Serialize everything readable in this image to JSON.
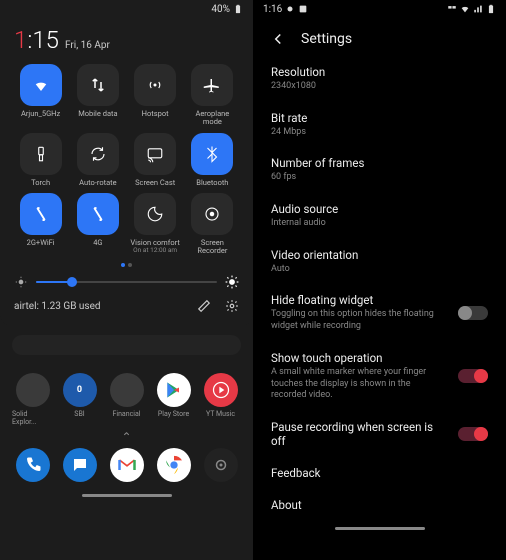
{
  "left": {
    "status": {
      "battery": "40%"
    },
    "clock": {
      "hour": "1",
      "rest": ":15",
      "date": "Fri, 16 Apr"
    },
    "tiles": [
      {
        "name": "wifi",
        "label": "Arjun_5GHz",
        "on": true
      },
      {
        "name": "mobile-data",
        "label": "Mobile data",
        "on": false
      },
      {
        "name": "hotspot",
        "label": "Hotspot",
        "on": false
      },
      {
        "name": "aeroplane",
        "label": "Aeroplane mode",
        "on": false
      },
      {
        "name": "torch",
        "label": "Torch",
        "on": false
      },
      {
        "name": "auto-rotate",
        "label": "Auto-rotate",
        "on": false
      },
      {
        "name": "screen-cast",
        "label": "Screen Cast",
        "on": false
      },
      {
        "name": "bluetooth",
        "label": "Bluetooth",
        "on": true
      },
      {
        "name": "2g-wifi",
        "label": "2G+WiFi",
        "on": true
      },
      {
        "name": "4g",
        "label": "4G",
        "on": true
      },
      {
        "name": "vision-comfort",
        "label": "Vision comfort",
        "sub": "On at 12:00 am",
        "on": false
      },
      {
        "name": "screen-recorder",
        "label": "Screen Recorder",
        "on": false
      }
    ],
    "brightness_pct": 20,
    "data_usage": "airtel: 1.23 GB used",
    "apps": [
      {
        "name": "solid-explorer",
        "label": "Solid Explor...",
        "color": "#3a3a3a"
      },
      {
        "name": "sbi",
        "label": "SBI",
        "color": "#1e5aab"
      },
      {
        "name": "financial",
        "label": "Financial",
        "color": "#3a3a3a"
      },
      {
        "name": "play-store",
        "label": "Play Store",
        "color": "#fff"
      },
      {
        "name": "yt-music",
        "label": "YT Music",
        "color": "#e63946"
      }
    ],
    "dock": [
      {
        "name": "phone",
        "color": "#1976d2"
      },
      {
        "name": "messages",
        "color": "#1976d2"
      },
      {
        "name": "gmail",
        "color": "#fff"
      },
      {
        "name": "chrome",
        "color": "#fff"
      },
      {
        "name": "camera",
        "color": "#222"
      }
    ]
  },
  "right": {
    "status": {
      "time": "1:16"
    },
    "title": "Settings",
    "items": [
      {
        "title": "Resolution",
        "sub": "2340x1080"
      },
      {
        "title": "Bit rate",
        "sub": "24 Mbps"
      },
      {
        "title": "Number of frames",
        "sub": "60 fps"
      },
      {
        "title": "Audio source",
        "sub": "Internal audio"
      },
      {
        "title": "Video orientation",
        "sub": "Auto"
      },
      {
        "title": "Hide floating widget",
        "sub": "Toggling on this option hides the floating widget while recording",
        "toggle": "off"
      },
      {
        "title": "Show touch operation",
        "sub": "A small white marker where your finger touches the display is shown in the recorded video.",
        "toggle": "on"
      },
      {
        "title": "Pause recording when screen is off",
        "toggle": "on"
      },
      {
        "title": "Feedback"
      },
      {
        "title": "About"
      }
    ]
  }
}
